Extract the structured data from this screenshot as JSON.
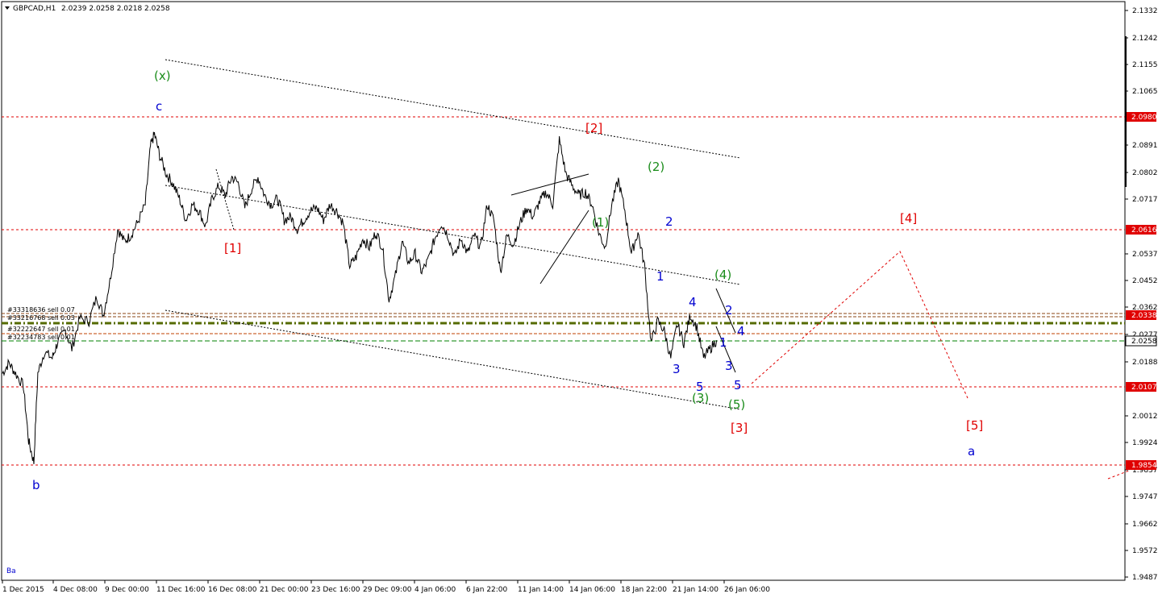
{
  "header": {
    "symbol": "GBPCAD,H1",
    "ohlc": "2.0239 2.0258 2.0218 2.0258",
    "corner_label": "Ba"
  },
  "colors": {
    "background": "#ffffff",
    "price_line": "#000000",
    "level_line": "#e00000",
    "price_tag_bg": "#e00000",
    "order_line_dark": "#556b00",
    "order_line_green": "#00a000",
    "wave_green": "#1a8c1a",
    "wave_blue": "#0000d0",
    "wave_red": "#e00000",
    "current_tag_bg": "#ffffff"
  },
  "chart_data": {
    "type": "line",
    "title": "GBPCAD,H1",
    "x_tick_labels": [
      "1 Dec 2015",
      "4 Dec 08:00",
      "9 Dec 00:00",
      "11 Dec 16:00",
      "16 Dec 08:00",
      "21 Dec 00:00",
      "23 Dec 16:00",
      "29 Dec 09:00",
      "4 Jan 06:00",
      "6 Jan 22:00",
      "11 Jan 14:00",
      "14 Jan 06:00",
      "18 Jan 22:00",
      "21 Jan 14:00",
      "26 Jan 06:00"
    ],
    "y_tick_labels": [
      "2.1332",
      "2.1242",
      "2.1155",
      "2.1065",
      "2.0980",
      "2.0891",
      "2.0802",
      "2.0717",
      "2.0616",
      "2.0537",
      "2.0452",
      "2.0362",
      "2.0338",
      "2.0277",
      "2.0258",
      "2.0188",
      "2.0107",
      "2.0012",
      "1.9924",
      "1.9854",
      "1.9837",
      "1.9747",
      "1.9662",
      "1.9572",
      "1.9487"
    ],
    "ylim": [
      1.9487,
      2.1332
    ],
    "price_path": [
      [
        0,
        2.015
      ],
      [
        0.5,
        2.0185
      ],
      [
        1,
        2.015
      ],
      [
        1.6,
        2.011
      ],
      [
        2.0,
        1.993
      ],
      [
        2.4,
        1.986
      ],
      [
        2.7,
        2.015
      ],
      [
        3.2,
        2.022
      ],
      [
        3.8,
        2.02
      ],
      [
        4.2,
        2.025
      ],
      [
        4.8,
        2.029
      ],
      [
        5.3,
        2.023
      ],
      [
        5.9,
        2.033
      ],
      [
        6.6,
        2.032
      ],
      [
        7.2,
        2.04
      ],
      [
        7.7,
        2.034
      ],
      [
        8.2,
        2.045
      ],
      [
        8.8,
        2.062
      ],
      [
        9.3,
        2.058
      ],
      [
        9.8,
        2.06
      ],
      [
        10.3,
        2.064
      ],
      [
        10.9,
        2.07
      ],
      [
        11.3,
        2.089
      ],
      [
        11.6,
        2.093
      ],
      [
        12.0,
        2.086
      ],
      [
        12.5,
        2.08
      ],
      [
        13.0,
        2.077
      ],
      [
        13.5,
        2.072
      ],
      [
        14.0,
        2.065
      ],
      [
        14.5,
        2.07
      ],
      [
        15.0,
        2.068
      ],
      [
        15.5,
        2.063
      ],
      [
        16.0,
        2.072
      ],
      [
        16.5,
        2.076
      ],
      [
        17.0,
        2.073
      ],
      [
        17.5,
        2.079
      ],
      [
        18.0,
        2.077
      ],
      [
        18.5,
        2.069
      ],
      [
        19.0,
        2.075
      ],
      [
        19.5,
        2.079
      ],
      [
        20.0,
        2.073
      ],
      [
        20.5,
        2.07
      ],
      [
        21.0,
        2.072
      ],
      [
        21.5,
        2.065
      ],
      [
        22.0,
        2.066
      ],
      [
        22.5,
        2.062
      ],
      [
        23.0,
        2.065
      ],
      [
        23.5,
        2.068
      ],
      [
        24.0,
        2.069
      ],
      [
        24.5,
        2.065
      ],
      [
        25.0,
        2.07
      ],
      [
        25.5,
        2.068
      ],
      [
        26.0,
        2.064
      ],
      [
        26.5,
        2.05
      ],
      [
        27.0,
        2.053
      ],
      [
        27.5,
        2.059
      ],
      [
        28.0,
        2.056
      ],
      [
        28.5,
        2.061
      ],
      [
        29.0,
        2.056
      ],
      [
        29.5,
        2.039
      ],
      [
        30.0,
        2.047
      ],
      [
        30.5,
        2.058
      ],
      [
        31.0,
        2.051
      ],
      [
        31.5,
        2.054
      ],
      [
        32.0,
        2.048
      ],
      [
        32.5,
        2.052
      ],
      [
        33.0,
        2.059
      ],
      [
        33.5,
        2.064
      ],
      [
        34.0,
        2.06
      ],
      [
        34.5,
        2.053
      ],
      [
        35.0,
        2.059
      ],
      [
        35.5,
        2.054
      ],
      [
        36.0,
        2.06
      ],
      [
        36.5,
        2.056
      ],
      [
        37.0,
        2.07
      ],
      [
        37.5,
        2.065
      ],
      [
        38.0,
        2.048
      ],
      [
        38.5,
        2.06
      ],
      [
        39.0,
        2.057
      ],
      [
        39.5,
        2.064
      ],
      [
        40.0,
        2.069
      ],
      [
        40.5,
        2.066
      ],
      [
        41.0,
        2.071
      ],
      [
        41.5,
        2.074
      ],
      [
        42.0,
        2.07
      ],
      [
        42.5,
        2.091
      ],
      [
        43.0,
        2.08
      ],
      [
        43.5,
        2.076
      ],
      [
        44.0,
        2.073
      ],
      [
        44.5,
        2.074
      ],
      [
        45.0,
        2.07
      ],
      [
        45.5,
        2.061
      ],
      [
        46.0,
        2.056
      ],
      [
        46.5,
        2.07
      ],
      [
        47.0,
        2.078
      ],
      [
        47.5,
        2.068
      ],
      [
        48.0,
        2.054
      ],
      [
        48.5,
        2.061
      ],
      [
        49.0,
        2.05
      ],
      [
        49.5,
        2.025
      ],
      [
        50.0,
        2.032
      ],
      [
        50.5,
        2.029
      ],
      [
        51.0,
        2.02
      ],
      [
        51.5,
        2.031
      ],
      [
        52.0,
        2.025
      ],
      [
        52.5,
        2.034
      ],
      [
        53.0,
        2.03
      ],
      [
        53.5,
        2.02
      ],
      [
        54.0,
        2.023
      ],
      [
        54.5,
        2.0258
      ]
    ],
    "horizontal_levels": [
      {
        "value": 2.098,
        "label": "2.0980"
      },
      {
        "value": 2.0616,
        "label": "2.0616"
      },
      {
        "value": 2.0107,
        "label": "2.0107"
      },
      {
        "value": 1.9854,
        "label": "1.9854"
      }
    ],
    "current_price": "2.0258",
    "orders": [
      "#33318636 sell 0.07",
      "#33216768 sell 0.03",
      "#32222647 sell 0.01",
      "#32234783 sell 0.01"
    ],
    "wave_labels": {
      "green": [
        "(x)",
        "(2)",
        "(1)",
        "(4)",
        "(3)",
        "(5)"
      ],
      "blue": [
        "c",
        "b",
        "2",
        "1",
        "4",
        "3",
        "5",
        "2",
        "1",
        "3",
        "4",
        "5",
        "a"
      ],
      "red": [
        "[1]",
        "[2]",
        "[3]",
        "[4]",
        "[5]"
      ]
    }
  }
}
